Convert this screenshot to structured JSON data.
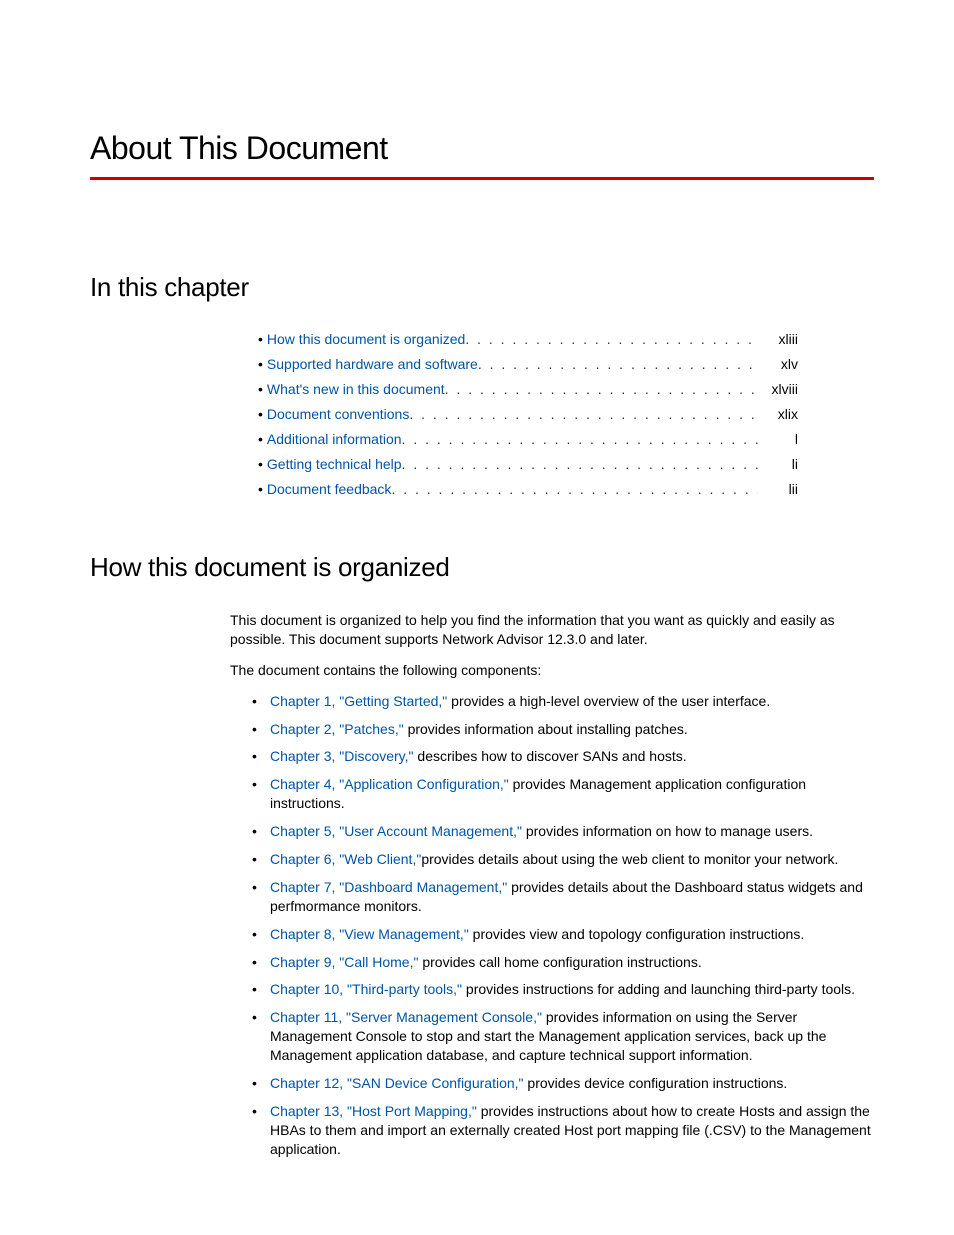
{
  "title": "About This Document",
  "toc": {
    "heading": "In this chapter",
    "items": [
      {
        "label": "How this document is organized",
        "page": "xliii"
      },
      {
        "label": "Supported hardware and software",
        "page": "xlv"
      },
      {
        "label": "What's new in this document",
        "page": "xlviii"
      },
      {
        "label": "Document conventions",
        "page": "xlix"
      },
      {
        "label": "Additional information",
        "page": "l"
      },
      {
        "label": "Getting technical help",
        "page": "li"
      },
      {
        "label": "Document feedback",
        "page": "lii"
      }
    ]
  },
  "section": {
    "heading": "How this document is organized",
    "intro1": "This document is organized to help you find the information that you want as quickly and easily as possible. This document supports Network Advisor 12.3.0 and later.",
    "intro2": "The document contains the following components:",
    "chapters": [
      {
        "link": "Chapter 1, \"Getting Started,\"",
        "text": " provides a high-level overview of the user interface."
      },
      {
        "link": "Chapter 2, \"Patches,\"",
        "text": " provides information about installing patches."
      },
      {
        "link": "Chapter 3, \"Discovery,\"",
        "text": " describes how to discover SANs and hosts."
      },
      {
        "link": "Chapter 4, \"Application Configuration,\"",
        "text": " provides Management application configuration instructions."
      },
      {
        "link": "Chapter 5, \"User Account Management,\"",
        "text": " provides information on how to manage users."
      },
      {
        "link": "Chapter 6, \"Web Client,\"",
        "text": "provides details about using the web client to monitor your network."
      },
      {
        "link": "Chapter 7, \"Dashboard Management,\"",
        "text": " provides details about the Dashboard status widgets and perfmormance monitors."
      },
      {
        "link": "Chapter 8, \"View Management,\"",
        "text": " provides view and topology configuration instructions."
      },
      {
        "link": "Chapter 9, \"Call Home,\"",
        "text": " provides call home configuration instructions."
      },
      {
        "link": "Chapter 10, \"Third-party tools,\"",
        "text": " provides instructions for adding and launching third-party tools."
      },
      {
        "link": "Chapter 11, \"Server Management Console,\"",
        "text": " provides information on using the Server Management Console to stop and start the Management application services, back up the Management application database, and capture technical support information."
      },
      {
        "link": "Chapter 12, \"SAN Device Configuration,\"",
        "text": " provides device configuration instructions."
      },
      {
        "link": "Chapter 13, \"Host Port Mapping,\"",
        "text": " provides instructions about how to create Hosts and assign the HBAs to them and import an externally created Host port mapping file (.CSV) to the Management application."
      }
    ]
  }
}
